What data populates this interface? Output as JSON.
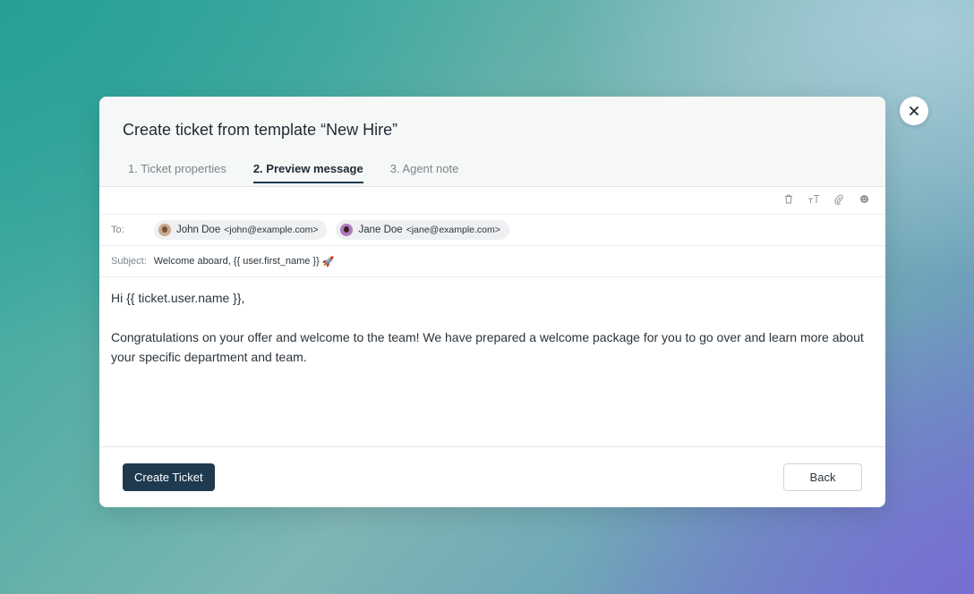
{
  "modal": {
    "title": "Create ticket from template “New Hire”",
    "tabs": [
      {
        "label": "1. Ticket properties",
        "active": false
      },
      {
        "label": "2. Preview message",
        "active": true
      },
      {
        "label": "3. Agent note",
        "active": false
      }
    ],
    "toolbar": {
      "icons": [
        "trash-icon",
        "text-size-icon",
        "paperclip-icon",
        "emoji-icon"
      ]
    },
    "to": {
      "label": "To:",
      "recipients": [
        {
          "name": "John Doe",
          "email": "<john@example.com>"
        },
        {
          "name": "Jane Doe",
          "email": "<jane@example.com>"
        }
      ]
    },
    "subject": {
      "label": "Subject:",
      "value": "Welcome aboard, {{ user.first_name }}",
      "emoji": "🚀"
    },
    "message": {
      "greeting": "Hi {{ ticket.user.name }},",
      "paragraph": "Congratulations on your offer and welcome to the team! We have prepared a welcome package for you to go over and learn more about your specific department and team."
    },
    "footer": {
      "primary_label": "Create Ticket",
      "secondary_label": "Back"
    }
  },
  "colors": {
    "primary_button": "#1f3a4f",
    "active_tab_underline": "#1f3a50"
  }
}
